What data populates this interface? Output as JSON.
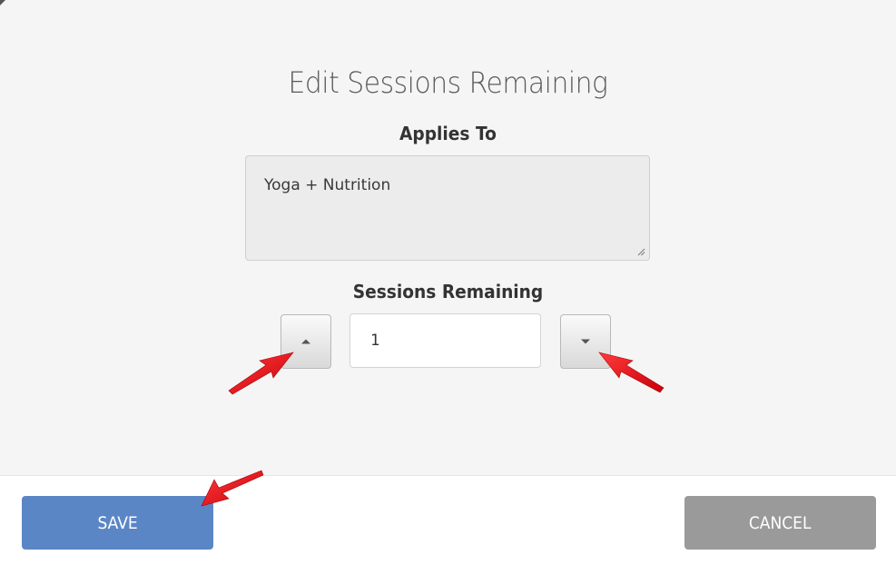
{
  "dialog": {
    "title": "Edit Sessions Remaining",
    "applies_to_label": "Applies To",
    "applies_to_value": "Yoga + Nutrition",
    "sessions_label": "Sessions Remaining",
    "sessions_value": "1",
    "stepper_up_icon": "caret-up-icon",
    "stepper_down_icon": "caret-down-icon"
  },
  "footer": {
    "save_label": "SAVE",
    "cancel_label": "CANCEL"
  },
  "colors": {
    "body_bg": "#f5f5f5",
    "save_bg": "#5b86c5",
    "cancel_bg": "#9a9a9a",
    "annotation_arrow": "#e8101a"
  }
}
